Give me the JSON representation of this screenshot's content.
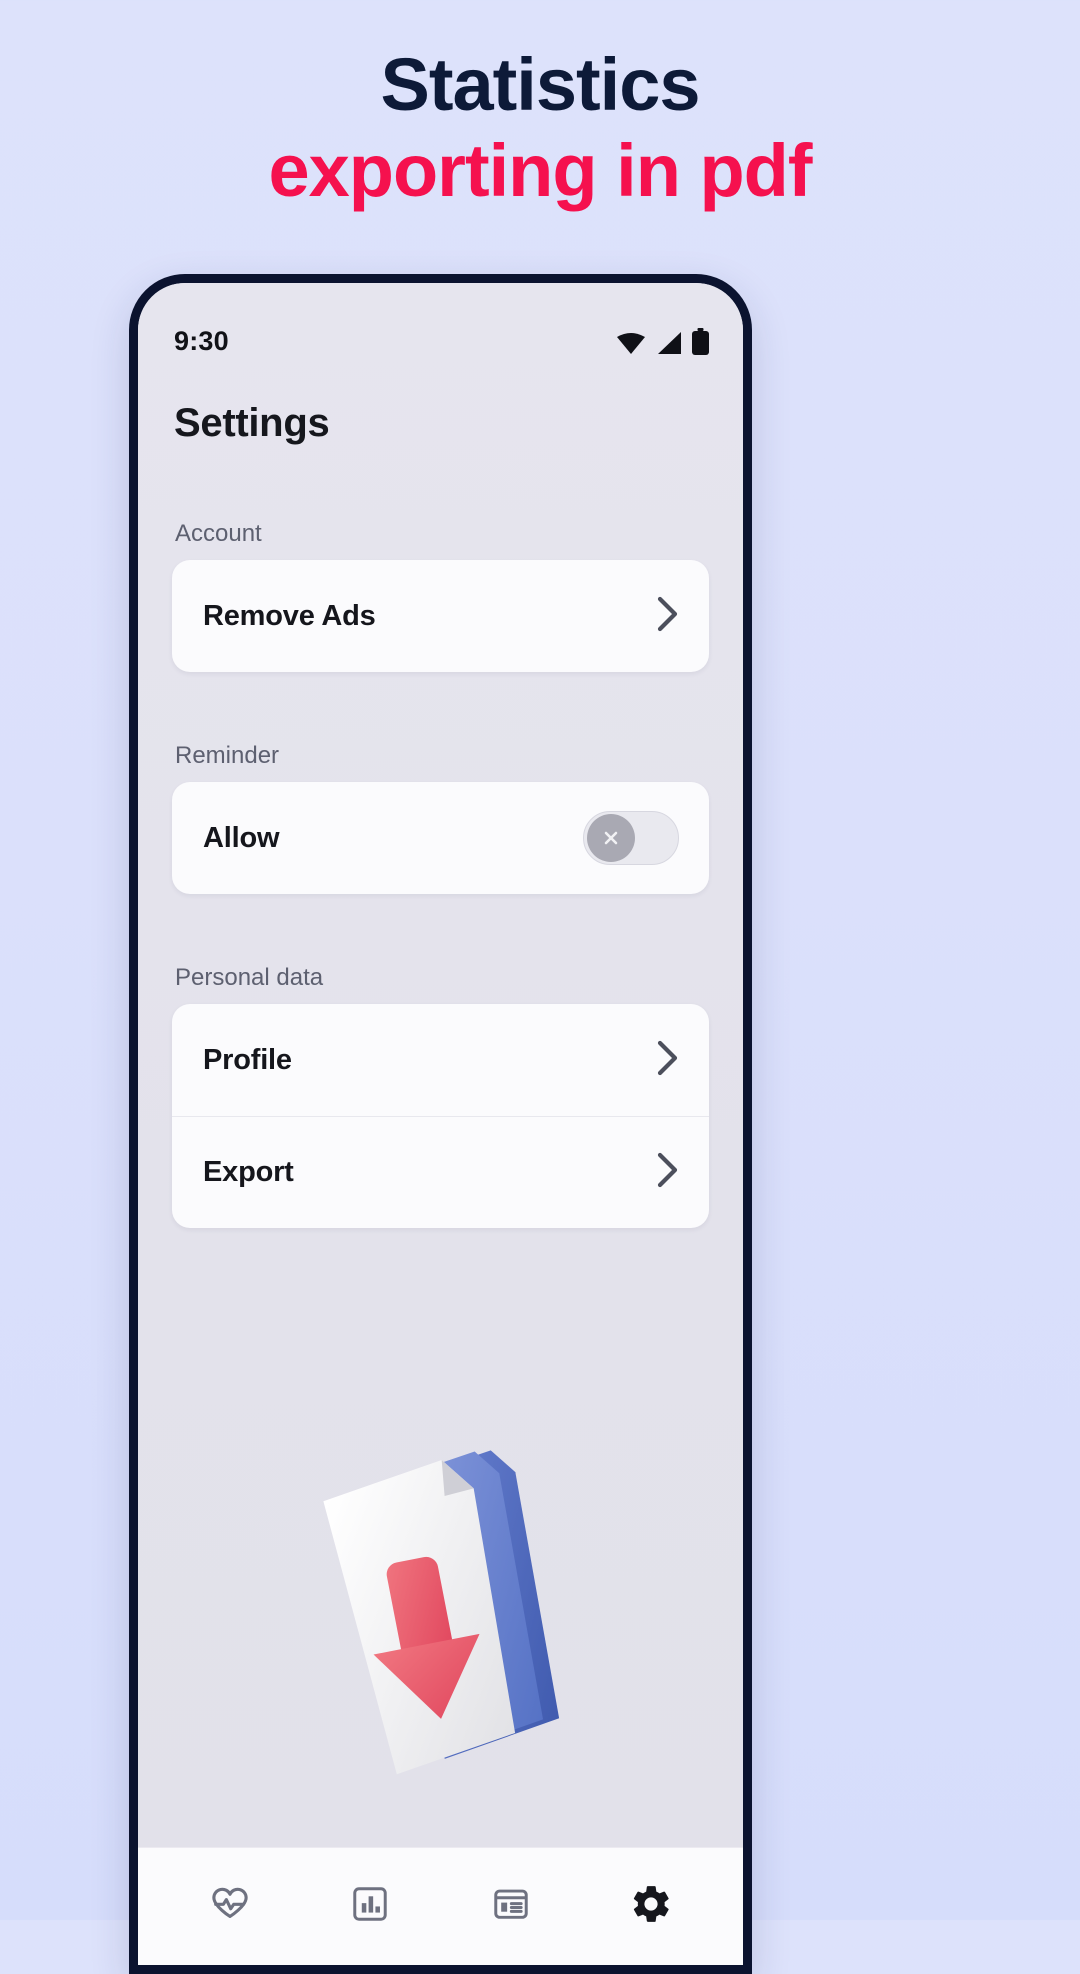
{
  "promo": {
    "line1": "Statistics",
    "line2": "exporting in pdf",
    "line1_color": "#0d1a38",
    "line2_color": "#f5114e",
    "background_color": "#dde2fb"
  },
  "phone": {
    "frame_color": "#0b132f",
    "screen_background": "#e4e3ec"
  },
  "statusbar": {
    "time": "9:30",
    "icons": [
      "wifi-icon",
      "cellular-signal-icon",
      "battery-icon"
    ]
  },
  "app": {
    "title": "Settings",
    "sections": [
      {
        "label": "Account",
        "rows": [
          {
            "label": "Remove Ads",
            "accessory": "chevron-right-icon"
          }
        ]
      },
      {
        "label": "Reminder",
        "rows": [
          {
            "label": "Allow",
            "accessory": "toggle-switch",
            "toggle_on": false,
            "knob_glyph": "close-icon"
          }
        ]
      },
      {
        "label": "Personal data",
        "rows": [
          {
            "label": "Profile",
            "accessory": "chevron-right-icon"
          },
          {
            "label": "Export",
            "accessory": "chevron-right-icon"
          }
        ]
      }
    ],
    "illustration": {
      "name": "export-download-document-3d-illustration",
      "arrow_color": "#ec5c68",
      "page_color": "#f2f2f4",
      "stack_color": "#4e6cc4"
    },
    "bottom_nav": {
      "items": [
        {
          "name": "nav-activity",
          "icon": "heart-pulse-icon",
          "active": false
        },
        {
          "name": "nav-statistics",
          "icon": "bar-chart-icon",
          "active": false
        },
        {
          "name": "nav-journal",
          "icon": "calendar-list-icon",
          "active": false
        },
        {
          "name": "nav-settings",
          "icon": "gear-icon",
          "active": true
        }
      ],
      "active_color": "#16171d",
      "inactive_color": "#6e7180"
    }
  }
}
